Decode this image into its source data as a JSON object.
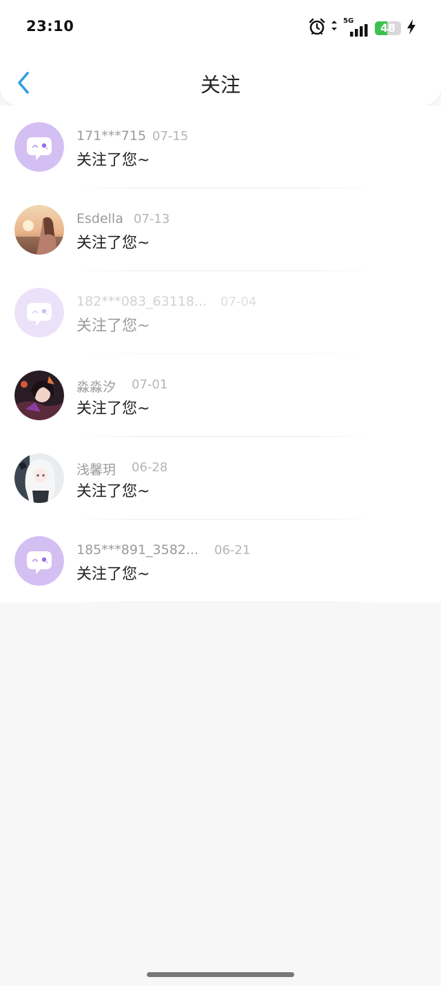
{
  "status_bar": {
    "time": "23:10",
    "network": "5G",
    "battery_level": "48",
    "battery_fraction": 0.48
  },
  "header": {
    "title": "关注"
  },
  "colors": {
    "default_avatar_bg": "#d4bff3",
    "battery_green": "#3dc24f",
    "back_arrow": "#2a9be6"
  },
  "follow_list": {
    "items": [
      {
        "name": "171***715",
        "date": "07-15",
        "message": "关注了您~",
        "avatar": "default-chat-avatar",
        "faded": false
      },
      {
        "name": "Esdella",
        "date": "07-13",
        "message": "关注了您~",
        "avatar": "photo-sunset-girl",
        "faded": false
      },
      {
        "name": "182***083_63118...",
        "date": "07-04",
        "message": "关注了您~",
        "avatar": "default-chat-avatar",
        "faded": true
      },
      {
        "name": "淼淼汐",
        "date": "07-01",
        "message": "关注了您~",
        "avatar": "anime-dark-girl",
        "faded": false
      },
      {
        "name": "浅馨玥",
        "date": "06-28",
        "message": "关注了您~",
        "avatar": "anime-white-hair-girl",
        "faded": false
      },
      {
        "name": "185***891_3582...",
        "date": "06-21",
        "message": "关注了您~",
        "avatar": "default-chat-avatar",
        "faded": false
      }
    ]
  }
}
